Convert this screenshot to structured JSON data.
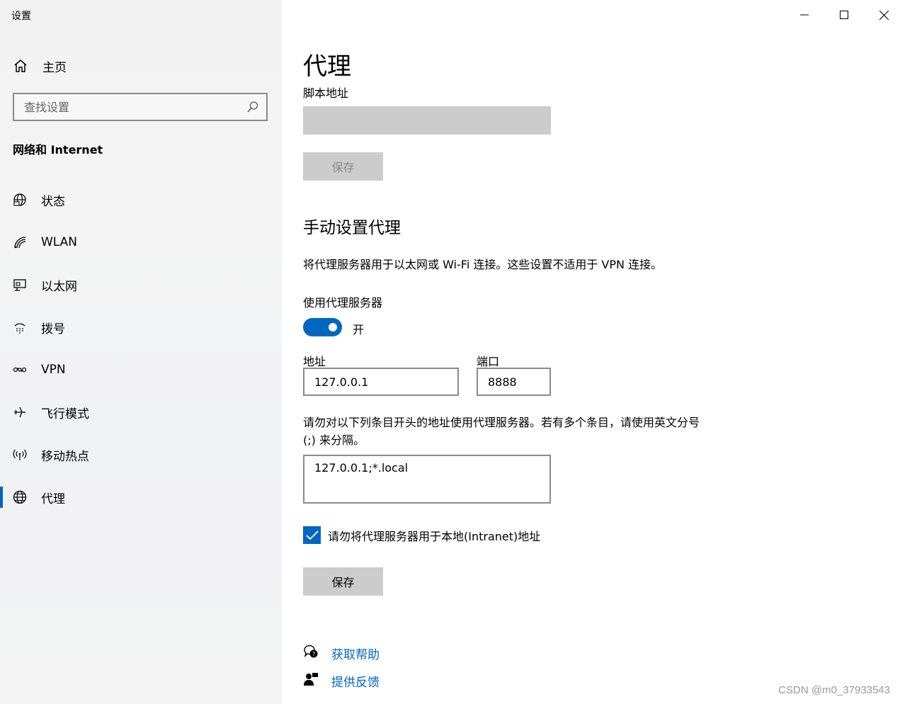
{
  "app": {
    "title": "设置"
  },
  "sidebar": {
    "home_label": "主页",
    "search_placeholder": "查找设置",
    "section_title": "网络和 Internet",
    "items": [
      {
        "label": "状态",
        "icon": "globe-status-icon"
      },
      {
        "label": "WLAN",
        "icon": "wifi-icon"
      },
      {
        "label": "以太网",
        "icon": "ethernet-icon"
      },
      {
        "label": "拨号",
        "icon": "dialup-icon"
      },
      {
        "label": "VPN",
        "icon": "vpn-icon"
      },
      {
        "label": "飞行模式",
        "icon": "airplane-icon"
      },
      {
        "label": "移动热点",
        "icon": "hotspot-icon"
      },
      {
        "label": "代理",
        "icon": "globe-icon",
        "active": true
      }
    ]
  },
  "main": {
    "title": "代理",
    "script_address_label": "脚本地址",
    "script_save_label": "保存",
    "manual_heading": "手动设置代理",
    "manual_desc": "将代理服务器用于以太网或 Wi-Fi 连接。这些设置不适用于 VPN 连接。",
    "use_proxy_label": "使用代理服务器",
    "toggle_state": "开",
    "address_label": "地址",
    "address_value": "127.0.0.1",
    "port_label": "端口",
    "port_value": "8888",
    "exceptions_text": "请勿对以下列条目开头的地址使用代理服务器。若有多个条目，请使用英文分号 (;) 来分隔。",
    "exceptions_value": "127.0.0.1;*.local",
    "bypass_local_label": "请勿将代理服务器用于本地(Intranet)地址",
    "bypass_local_checked": true,
    "save_label": "保存",
    "help_link": "获取帮助",
    "feedback_link": "提供反馈"
  },
  "watermark": "CSDN @m0_37933543",
  "colors": {
    "accent": "#0067c0",
    "button_bg": "#cccccc",
    "border": "#8a8a8a"
  }
}
